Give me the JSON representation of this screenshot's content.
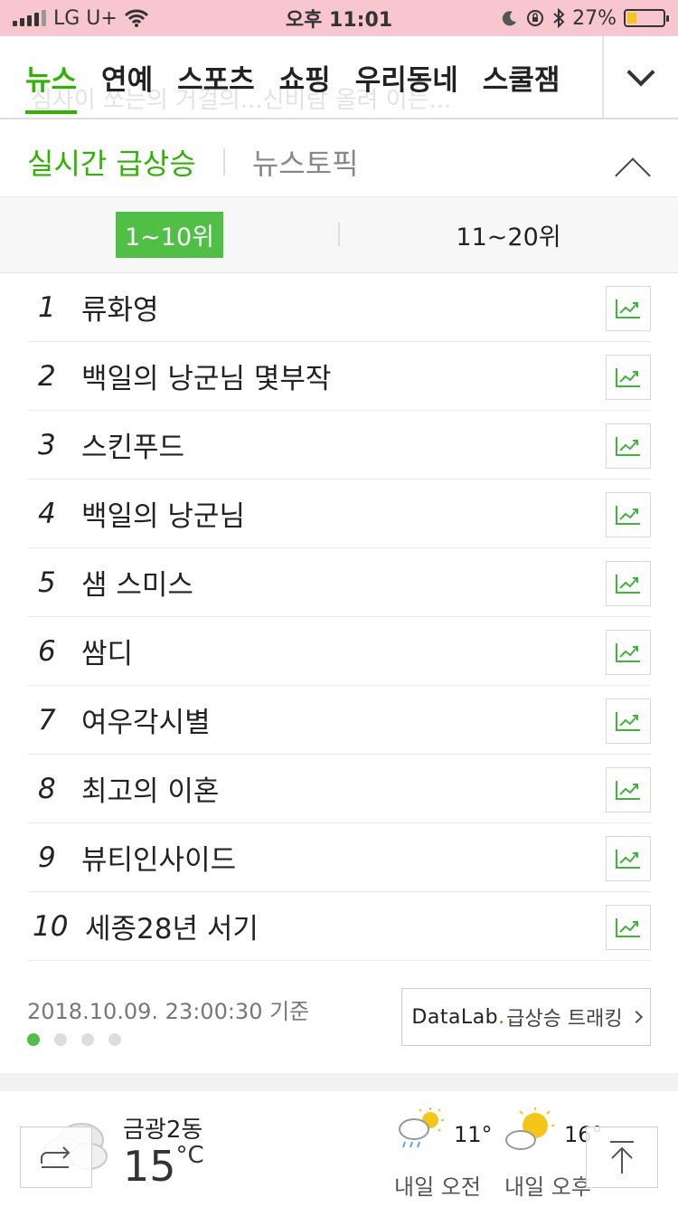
{
  "status": {
    "carrier": "LG U+",
    "time": "오후 11:01",
    "battery": "27%",
    "battery_level": 0.27
  },
  "tabs": [
    {
      "label": "뉴스",
      "active": true
    },
    {
      "label": "연예",
      "active": false
    },
    {
      "label": "스포츠",
      "active": false
    },
    {
      "label": "쇼핑",
      "active": false
    },
    {
      "label": "우리동네",
      "active": false
    },
    {
      "label": "스쿨잼",
      "active": false
    }
  ],
  "tabs_ghost_text": "심사이 쏘는의 거걸의...신비람 올려 이는...",
  "section": {
    "title": "실시간 급상승",
    "subtitle": "뉴스토픽"
  },
  "ranges": {
    "first": "1~10위",
    "second": "11~20위"
  },
  "ranking": [
    {
      "rank": "1",
      "keyword": "류화영"
    },
    {
      "rank": "2",
      "keyword": "백일의 낭군님 몇부작"
    },
    {
      "rank": "3",
      "keyword": "스킨푸드"
    },
    {
      "rank": "4",
      "keyword": "백일의 낭군님"
    },
    {
      "rank": "5",
      "keyword": "샘 스미스"
    },
    {
      "rank": "6",
      "keyword": "쌈디"
    },
    {
      "rank": "7",
      "keyword": "여우각시별"
    },
    {
      "rank": "8",
      "keyword": "최고의 이혼"
    },
    {
      "rank": "9",
      "keyword": "뷰티인사이드"
    },
    {
      "rank": "10",
      "keyword": "세종28년 서기"
    }
  ],
  "footer": {
    "timestamp": "2018.10.09. 23:00:30 기준",
    "datalab_brand": "DataLab",
    "datalab_dot": ".",
    "datalab_label": "급상승 트래킹",
    "pages": 4,
    "active_page": 1
  },
  "weather": {
    "location": "금광2동",
    "temp": "15",
    "unit": "°C",
    "forecast": [
      {
        "label": "내일 오전",
        "temp": "11°",
        "icon": "rain-sun-icon"
      },
      {
        "label": "내일 오후",
        "temp": "16°",
        "icon": "partly-cloudy-icon"
      }
    ]
  },
  "colors": {
    "accent": "#2db400",
    "status_bar": "#f7c6cf"
  }
}
